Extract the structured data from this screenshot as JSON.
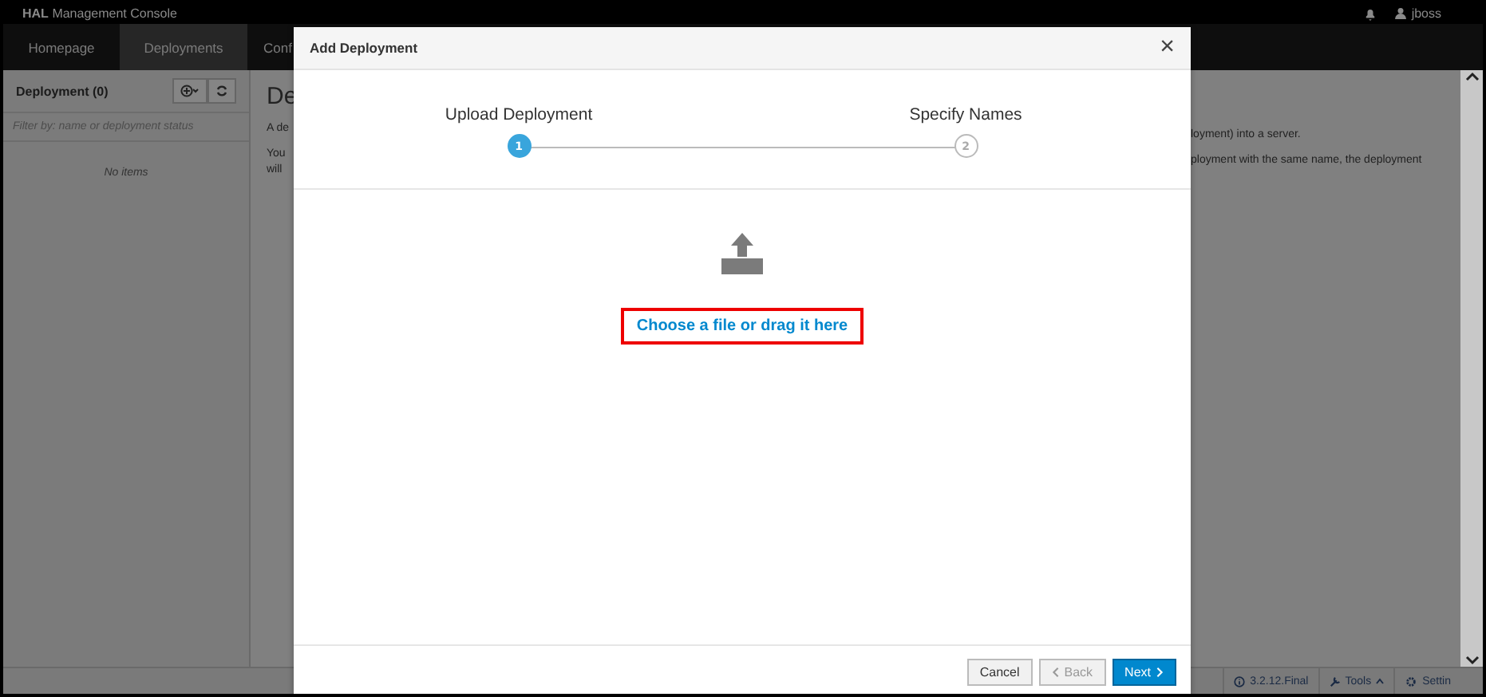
{
  "app": {
    "brand_bold": "HAL",
    "brand_rest": "Management Console",
    "user": "jboss"
  },
  "nav_tabs": [
    {
      "label": "Homepage",
      "selected": false
    },
    {
      "label": "Deployments",
      "selected": true
    },
    {
      "label": "Conf",
      "selected": false
    }
  ],
  "sidebar": {
    "title": "Deployment (0)",
    "filter": {
      "placeholder": "Filter by: name or deployment status"
    },
    "empty_text": "No items"
  },
  "content": {
    "heading": "De",
    "left_lines": [
      "A de",
      "You",
      "will"
    ],
    "right_lines": [
      "loyment) into a server.",
      "ployment with the same name, the deployment"
    ]
  },
  "footer": {
    "version": "3.2.12.Final",
    "tools": "Tools",
    "settings": "Settin"
  },
  "dialog": {
    "title": "Add Deployment",
    "close": "×",
    "steps": [
      {
        "label": "Upload Deployment",
        "number": "1",
        "selected": true
      },
      {
        "label": "Specify Names",
        "number": "2",
        "selected": false
      }
    ],
    "upload_link": {
      "text": "Choose a file or drag it here",
      "highlighted": true
    },
    "buttons": [
      {
        "kind": "default",
        "label": "Cancel",
        "disabled": false
      },
      {
        "kind": "back",
        "label": "Back",
        "disabled": true
      },
      {
        "kind": "primary",
        "label": "Next",
        "disabled": false
      }
    ]
  }
}
